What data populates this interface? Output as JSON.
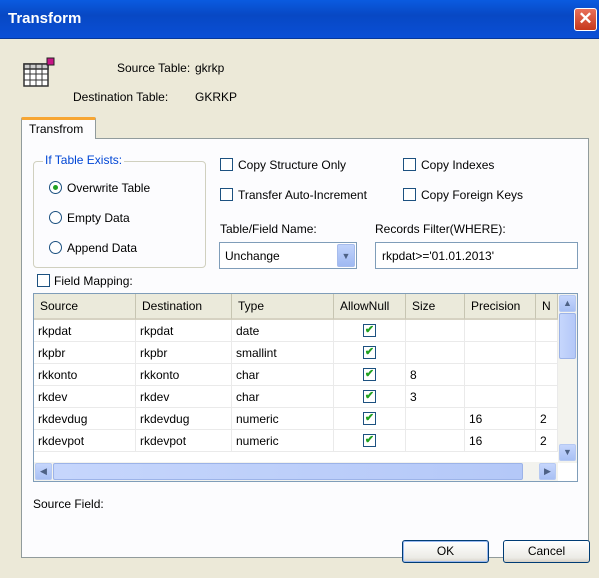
{
  "window": {
    "title": "Transform",
    "close_glyph": "✕"
  },
  "info": {
    "source_label": "Source Table:",
    "source_value": "gkrkp",
    "dest_label": "Destination Table:",
    "dest_value": "GKRKP",
    "icon": "table-grid-icon"
  },
  "tab": {
    "label": "Transfrom"
  },
  "if_table_exists": {
    "legend": "If Table Exists:",
    "options": [
      {
        "label": "Overwrite Table",
        "selected": true
      },
      {
        "label": "Empty Data",
        "selected": false
      },
      {
        "label": "Append Data",
        "selected": false
      }
    ]
  },
  "checkboxes": {
    "copy_structure_only": "Copy Structure Only",
    "copy_indexes": "Copy Indexes",
    "transfer_auto_increment": "Transfer Auto-Increment",
    "copy_foreign_keys": "Copy Foreign Keys",
    "field_mapping": "Field Mapping:"
  },
  "table_field_name": {
    "label": "Table/Field Name:",
    "value": "Unchange",
    "arrow": "▼"
  },
  "records_filter": {
    "label": "Records Filter(WHERE):",
    "value": "rkpdat>='01.01.2013'"
  },
  "grid": {
    "columns": [
      "Source",
      "Destination",
      "Type",
      "AllowNull",
      "Size",
      "Precision",
      "N"
    ],
    "rows": [
      {
        "source": "rkpdat",
        "destination": "rkpdat",
        "type": "date",
        "allow_null": true,
        "size": "",
        "precision": "",
        "n": ""
      },
      {
        "source": "rkpbr",
        "destination": "rkpbr",
        "type": "smallint",
        "allow_null": true,
        "size": "",
        "precision": "",
        "n": ""
      },
      {
        "source": "rkkonto",
        "destination": "rkkonto",
        "type": "char",
        "allow_null": true,
        "size": "8",
        "precision": "",
        "n": ""
      },
      {
        "source": "rkdev",
        "destination": "rkdev",
        "type": "char",
        "allow_null": true,
        "size": "3",
        "precision": "",
        "n": ""
      },
      {
        "source": "rkdevdug",
        "destination": "rkdevdug",
        "type": "numeric",
        "allow_null": true,
        "size": "",
        "precision": "16",
        "n": "2"
      },
      {
        "source": "rkdevpot",
        "destination": "rkdevpot",
        "type": "numeric",
        "allow_null": true,
        "size": "",
        "precision": "16",
        "n": "2"
      }
    ],
    "check_glyph": "✔",
    "scroll_up": "▲",
    "scroll_down": "▼",
    "scroll_left": "◀",
    "scroll_right": "▶"
  },
  "source_field": {
    "label": "Source Field:"
  },
  "buttons": {
    "ok": "OK",
    "cancel": "Cancel"
  }
}
